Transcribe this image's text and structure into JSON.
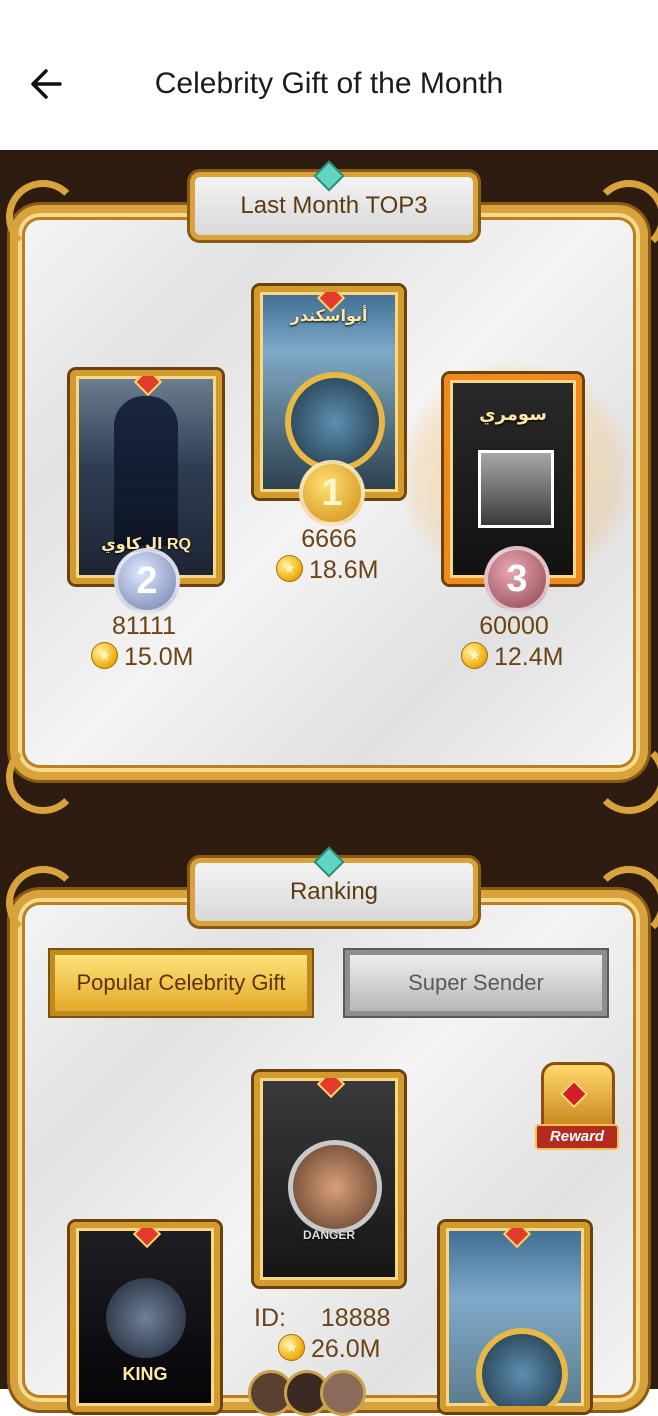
{
  "header": {
    "title": "Celebrity Gift of the Month",
    "back_icon": "arrow-left-icon"
  },
  "top3": {
    "section_label": "Last Month TOP3",
    "entries": [
      {
        "rank": "1",
        "id": "6666",
        "coins": "18.6M",
        "card_text": "أبواسكندر"
      },
      {
        "rank": "2",
        "id": "81111",
        "coins": "15.0M",
        "card_text": "الركاوي RQ"
      },
      {
        "rank": "3",
        "id": "60000",
        "coins": "12.4M",
        "card_text": "سومري"
      }
    ]
  },
  "ranking": {
    "section_label": "Ranking",
    "tabs": [
      {
        "label": "Popular Celebrity Gift",
        "active": true
      },
      {
        "label": "Super Sender",
        "active": false
      }
    ],
    "reward_label": "Reward",
    "leader": {
      "id_label": "ID:",
      "id": "18888",
      "coins": "26.0M",
      "card_text": "DANGER"
    },
    "left_card_text": "KING"
  },
  "colors": {
    "background_dark": "#2e1c10",
    "gold_frame": "#d8a23c",
    "text_brown": "#6b4416"
  }
}
